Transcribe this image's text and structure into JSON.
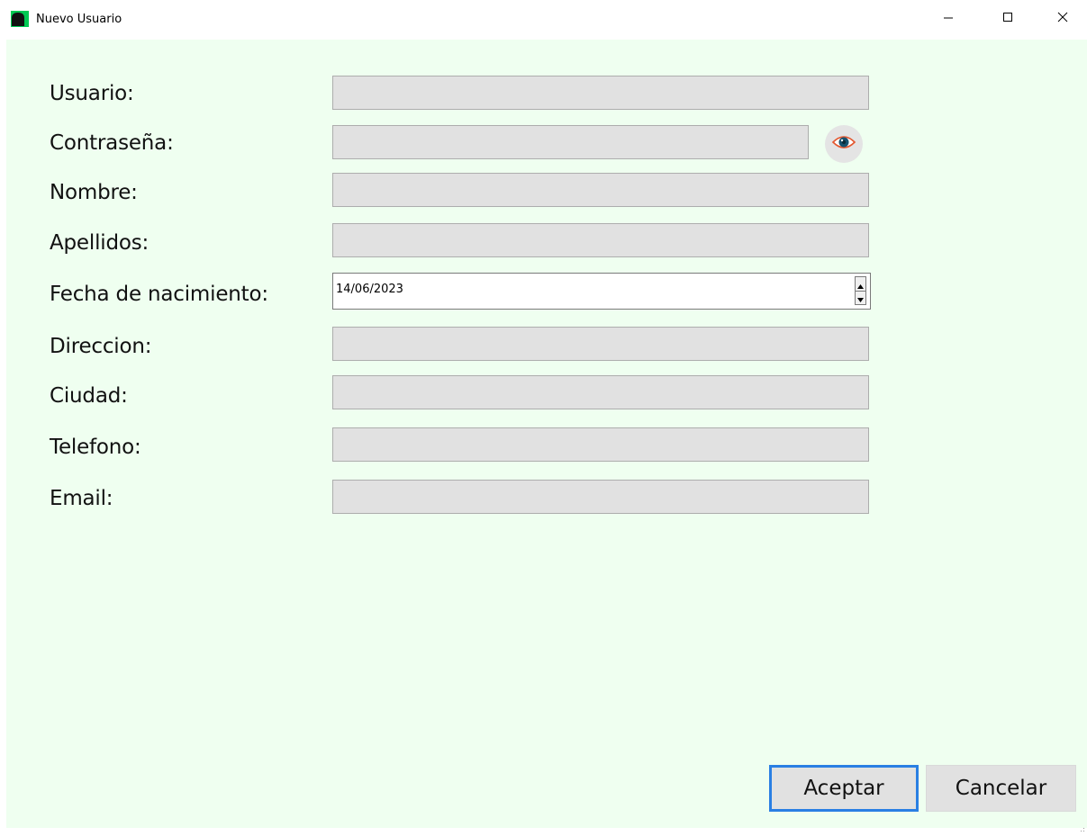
{
  "window": {
    "title": "Nuevo Usuario",
    "controls": {
      "minimize": "minimize-icon",
      "maximize": "maximize-icon",
      "close": "close-icon"
    }
  },
  "form": {
    "background_color": "#effff0",
    "fields": [
      {
        "key": "usuario",
        "label": "Usuario:",
        "value": ""
      },
      {
        "key": "contrasena",
        "label": "Contraseña:",
        "value": ""
      },
      {
        "key": "nombre",
        "label": "Nombre:",
        "value": ""
      },
      {
        "key": "apellidos",
        "label": "Apellidos:",
        "value": ""
      },
      {
        "key": "fecha_nacimiento",
        "label": "Fecha de nacimiento:",
        "value": "14/06/2023"
      },
      {
        "key": "direccion",
        "label": "Direccion:",
        "value": ""
      },
      {
        "key": "ciudad",
        "label": "Ciudad:",
        "value": ""
      },
      {
        "key": "telefono",
        "label": "Telefono:",
        "value": ""
      },
      {
        "key": "email",
        "label": "Email:",
        "value": ""
      }
    ],
    "show_password_icon": "eye-icon"
  },
  "actions": {
    "accept_label": "Aceptar",
    "cancel_label": "Cancelar",
    "accent_color": "#2a7fe3"
  }
}
